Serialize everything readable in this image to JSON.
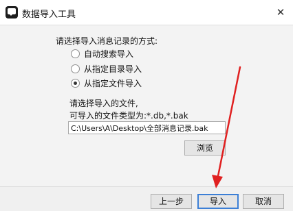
{
  "window": {
    "title": "数据导入工具",
    "app_icon": "chat-bubble-icon",
    "close_glyph": "✕"
  },
  "import_method": {
    "prompt": "请选择导入消息记录的方式:",
    "options": [
      {
        "label": "自动搜索导入",
        "checked": false
      },
      {
        "label": "从指定目录导入",
        "checked": false
      },
      {
        "label": "从指定文件导入",
        "checked": true
      }
    ]
  },
  "file_select": {
    "prompt": "请选择导入的文件,",
    "types_hint": "可导入的文件类型为:*.db,*.bak",
    "path_value": "C:\\Users\\A\\Desktop\\全部消息记录.bak",
    "browse_label": "浏览"
  },
  "footer": {
    "prev_label": "上一步",
    "import_label": "导入",
    "cancel_label": "取消"
  },
  "colors": {
    "annotation_arrow": "#e02020",
    "default_button_border": "#3c7fd6"
  }
}
